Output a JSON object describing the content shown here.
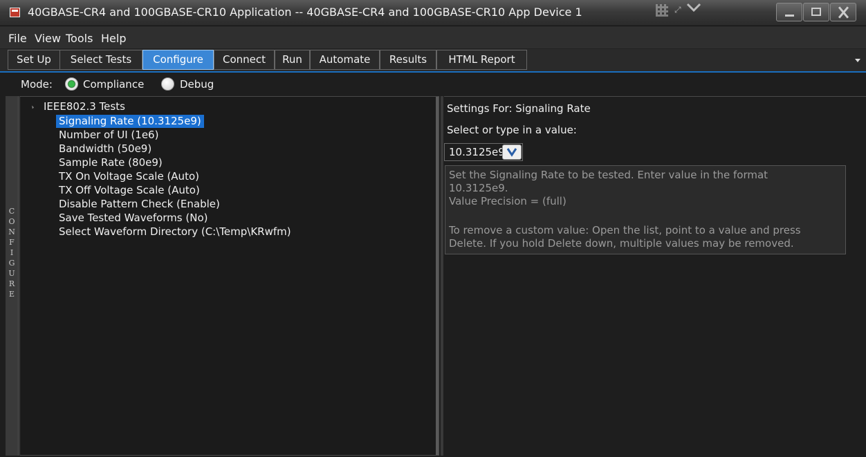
{
  "window": {
    "title": "40GBASE-CR4 and 100GBASE-CR10 Application -- 40GBASE-CR4 and 100GBASE-CR10 App Device 1"
  },
  "menu": [
    "File",
    "View",
    "Tools",
    "Help"
  ],
  "tabs": [
    {
      "label": "Set Up",
      "active": false
    },
    {
      "label": "Select Tests",
      "active": false
    },
    {
      "label": "Configure",
      "active": true
    },
    {
      "label": "Connect",
      "active": false
    },
    {
      "label": "Run",
      "active": false
    },
    {
      "label": "Automate",
      "active": false
    },
    {
      "label": "Results",
      "active": false
    },
    {
      "label": "HTML Report",
      "active": false
    }
  ],
  "mode": {
    "label": "Mode:",
    "options": [
      {
        "label": "Compliance",
        "checked": true
      },
      {
        "label": "Debug",
        "checked": false
      }
    ]
  },
  "side_label": "CONFIGURE",
  "tree": {
    "root": "IEEE802.3 Tests",
    "items": [
      {
        "label": "Signaling Rate (10.3125e9)",
        "selected": true
      },
      {
        "label": "Number of UI (1e6)",
        "selected": false
      },
      {
        "label": "Bandwidth (50e9)",
        "selected": false
      },
      {
        "label": "Sample Rate (80e9)",
        "selected": false
      },
      {
        "label": "TX On Voltage Scale (Auto)",
        "selected": false
      },
      {
        "label": "TX Off Voltage Scale (Auto)",
        "selected": false
      },
      {
        "label": "Disable Pattern Check (Enable)",
        "selected": false
      },
      {
        "label": "Save Tested Waveforms (No)",
        "selected": false
      },
      {
        "label": "Select Waveform Directory (C:\\Temp\\KRwfm)",
        "selected": false
      }
    ]
  },
  "settings": {
    "title": "Settings For: Signaling Rate",
    "prompt": "Select or type in a value:",
    "value": "10.3125e9",
    "help_lines": [
      "Set the Signaling Rate to be tested. Enter value in the format",
      "10.3125e9.",
      "Value Precision = (full)",
      "",
      "To remove a custom value: Open the list, point to a value and press",
      "Delete. If you hold Delete down, multiple values may be removed."
    ]
  },
  "colors": {
    "accent": "#3b87d6",
    "selection": "#1a6fd0",
    "background": "#1e1e1e",
    "radio_checked": "#38b84a"
  }
}
